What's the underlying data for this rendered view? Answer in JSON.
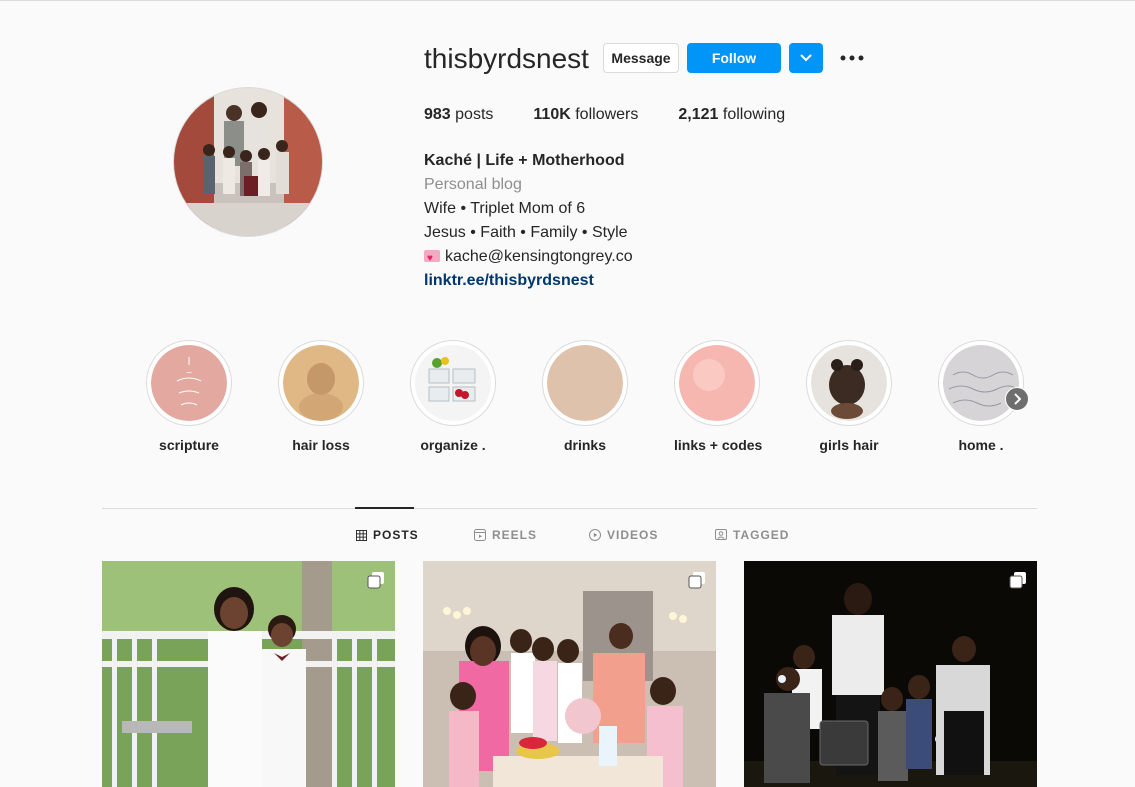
{
  "profile": {
    "username": "thisbyrdsnest",
    "message_label": "Message",
    "follow_label": "Follow",
    "stats": {
      "posts_count": "983",
      "posts_label": "posts",
      "followers_count": "110K",
      "followers_label": "followers",
      "following_count": "2,121",
      "following_label": "following"
    },
    "bio": {
      "name": "Kaché | Life + Motherhood",
      "category": "Personal blog",
      "line1": "Wife • Triplet Mom of 6",
      "line2": "Jesus • Faith • Family • Style",
      "email": "kache@kensingtongrey.co",
      "link": "linktr.ee/thisbyrdsnest"
    }
  },
  "highlights": [
    {
      "label": "scripture"
    },
    {
      "label": "hair loss"
    },
    {
      "label": "organize ."
    },
    {
      "label": "drinks"
    },
    {
      "label": "links + codes"
    },
    {
      "label": "girls hair"
    },
    {
      "label": "home ."
    }
  ],
  "tabs": [
    {
      "label": "POSTS",
      "icon": "grid-icon",
      "active": true
    },
    {
      "label": "REELS",
      "icon": "reels-icon",
      "active": false
    },
    {
      "label": "VIDEOS",
      "icon": "play-icon",
      "active": false
    },
    {
      "label": "TAGGED",
      "icon": "tag-icon",
      "active": false
    }
  ],
  "colors": {
    "accent": "#0095f6",
    "link": "#00376b",
    "muted": "#8e8e8e"
  }
}
